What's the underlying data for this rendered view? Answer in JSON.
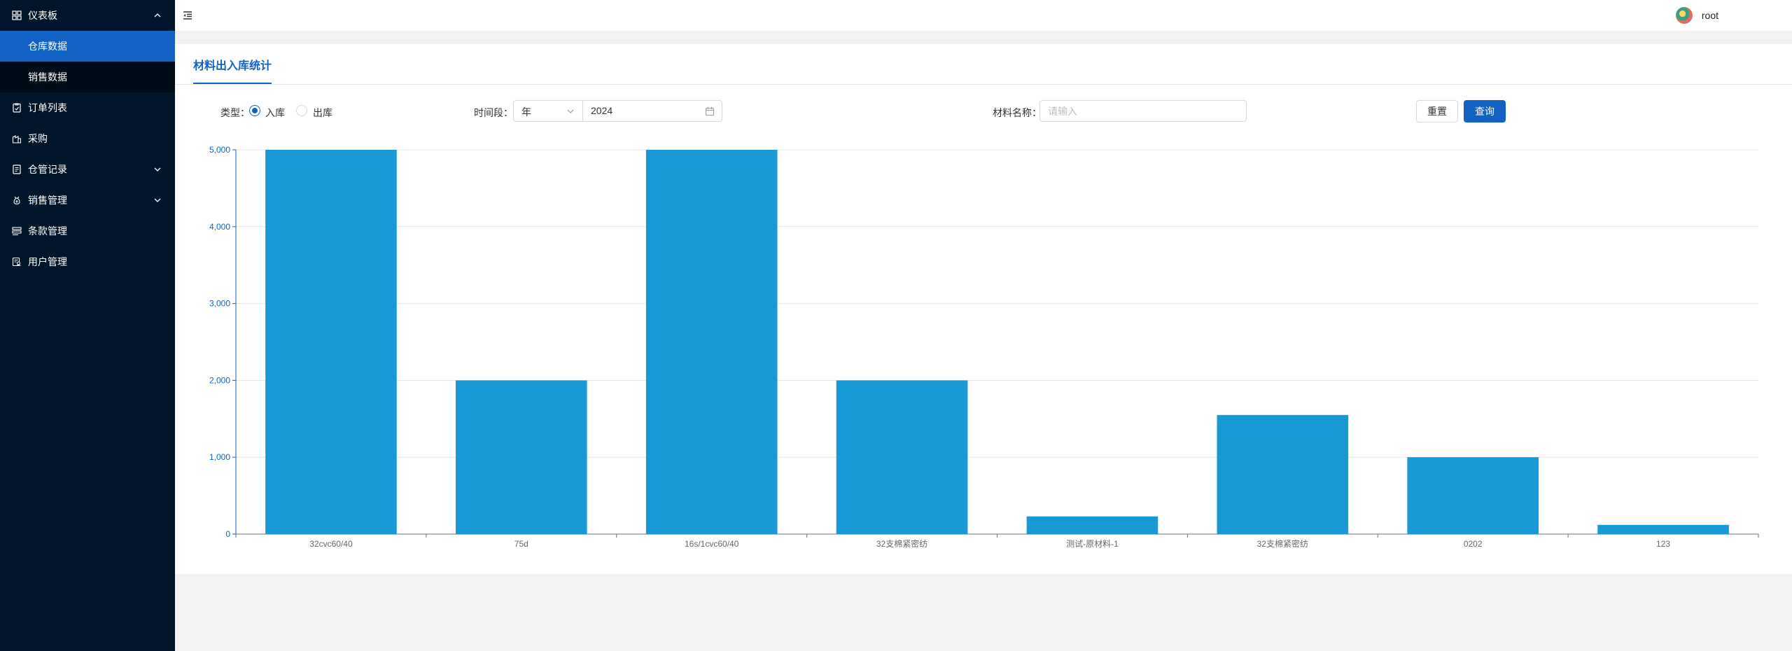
{
  "sidebar": {
    "menus": [
      {
        "label": "仪表板",
        "icon": "dashboard-icon",
        "expanded": true,
        "children": [
          {
            "label": "仓库数据",
            "active": true
          },
          {
            "label": "销售数据",
            "active": false
          }
        ]
      },
      {
        "label": "订单列表",
        "icon": "order-list-icon"
      },
      {
        "label": "采购",
        "icon": "purchase-icon"
      },
      {
        "label": "仓管记录",
        "icon": "warehouse-record-icon",
        "has_children": true
      },
      {
        "label": "销售管理",
        "icon": "sales-management-icon",
        "has_children": true
      },
      {
        "label": "条款管理",
        "icon": "terms-icon"
      },
      {
        "label": "用户管理",
        "icon": "user-management-icon"
      }
    ]
  },
  "header": {
    "username": "root"
  },
  "card": {
    "tab_title": "材料出入库统计"
  },
  "filters": {
    "type_label": "类型：",
    "type_options": [
      "入库",
      "出库"
    ],
    "type_selected": "入库",
    "period_label": "时间段：",
    "period_unit": "年",
    "period_value": "2024",
    "material_label": "材料名称：",
    "material_placeholder": "请输入",
    "reset_label": "重置",
    "query_label": "查询"
  },
  "colors": {
    "primary": "#1162c3",
    "bar": "#1899d5",
    "sidebar_bg": "#001529"
  },
  "chart_data": {
    "type": "bar",
    "categories": [
      "32cvc60/40",
      "75d",
      "16s/1cvc60/40",
      "32支棉紧密纺",
      "测试-原材料-1",
      "32支棉紧密纺",
      "0202",
      "123"
    ],
    "values": [
      5000,
      2000,
      5000,
      2000,
      230,
      1550,
      1000,
      120
    ],
    "yticks": [
      "0",
      "1,000",
      "2,000",
      "3,000",
      "4,000",
      "5,000"
    ],
    "ylim": [
      0,
      5000
    ],
    "grid": true,
    "title": "",
    "xlabel": "",
    "ylabel": ""
  }
}
